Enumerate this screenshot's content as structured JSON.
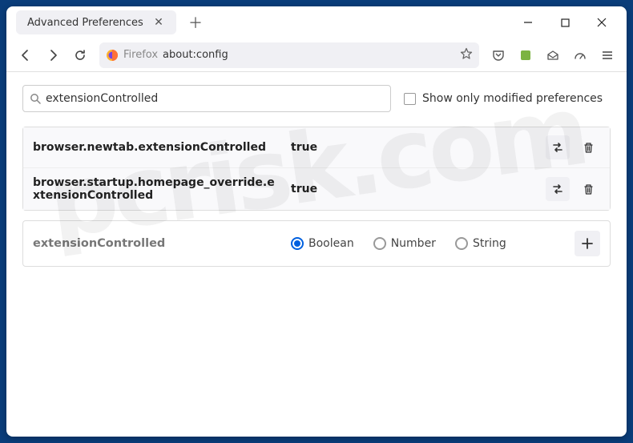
{
  "tab": {
    "title": "Advanced Preferences"
  },
  "urlbar": {
    "scheme": "Firefox",
    "url": "about:config"
  },
  "search": {
    "value": "extensionControlled",
    "placeholder": ""
  },
  "checkbox": {
    "label": "Show only modified preferences",
    "checked": false
  },
  "prefs": [
    {
      "name": "browser.newtab.extensionControlled",
      "value": "true"
    },
    {
      "name": "browser.startup.homepage_override.extensionControlled",
      "value": "true"
    }
  ],
  "addrow": {
    "name": "extensionControlled",
    "types": [
      {
        "label": "Boolean",
        "checked": true
      },
      {
        "label": "Number",
        "checked": false
      },
      {
        "label": "String",
        "checked": false
      }
    ]
  },
  "watermark": "pcrisk.com"
}
